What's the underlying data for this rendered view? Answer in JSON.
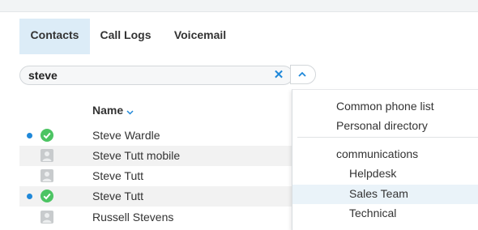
{
  "tabs": [
    {
      "label": "Contacts",
      "active": true
    },
    {
      "label": "Call Logs",
      "active": false
    },
    {
      "label": "Voicemail",
      "active": false
    }
  ],
  "search": {
    "value": "steve",
    "clear_icon": "close-icon",
    "toggle_icon": "chevron-up-icon"
  },
  "list": {
    "column_header": "Name",
    "sort_icon": "chevron-down-icon",
    "rows": [
      {
        "name": "Steve Wardle",
        "status": "online",
        "icon": "check-circle-icon"
      },
      {
        "name": "Steve Tutt mobile",
        "status": "none",
        "icon": "person-icon"
      },
      {
        "name": "Steve Tutt",
        "status": "none",
        "icon": "person-icon"
      },
      {
        "name": "Steve Tutt",
        "status": "online",
        "icon": "check-circle-icon"
      },
      {
        "name": "Russell Stevens",
        "status": "none",
        "icon": "person-icon"
      }
    ]
  },
  "directory_menu": {
    "items": [
      {
        "label": "Common phone list",
        "level": 0
      },
      {
        "label": "Personal directory",
        "level": 0
      },
      {
        "label": "communications",
        "level": 0
      },
      {
        "label": "Helpdesk",
        "level": 1
      },
      {
        "label": "Sales Team",
        "level": 1,
        "highlighted": true
      },
      {
        "label": "Technical",
        "level": 1
      }
    ]
  },
  "colors": {
    "accent": "#1f88d9",
    "online_green": "#4cc463",
    "active_tab_bg": "#dcecf7",
    "avatar_gray": "#c8cbcd"
  }
}
